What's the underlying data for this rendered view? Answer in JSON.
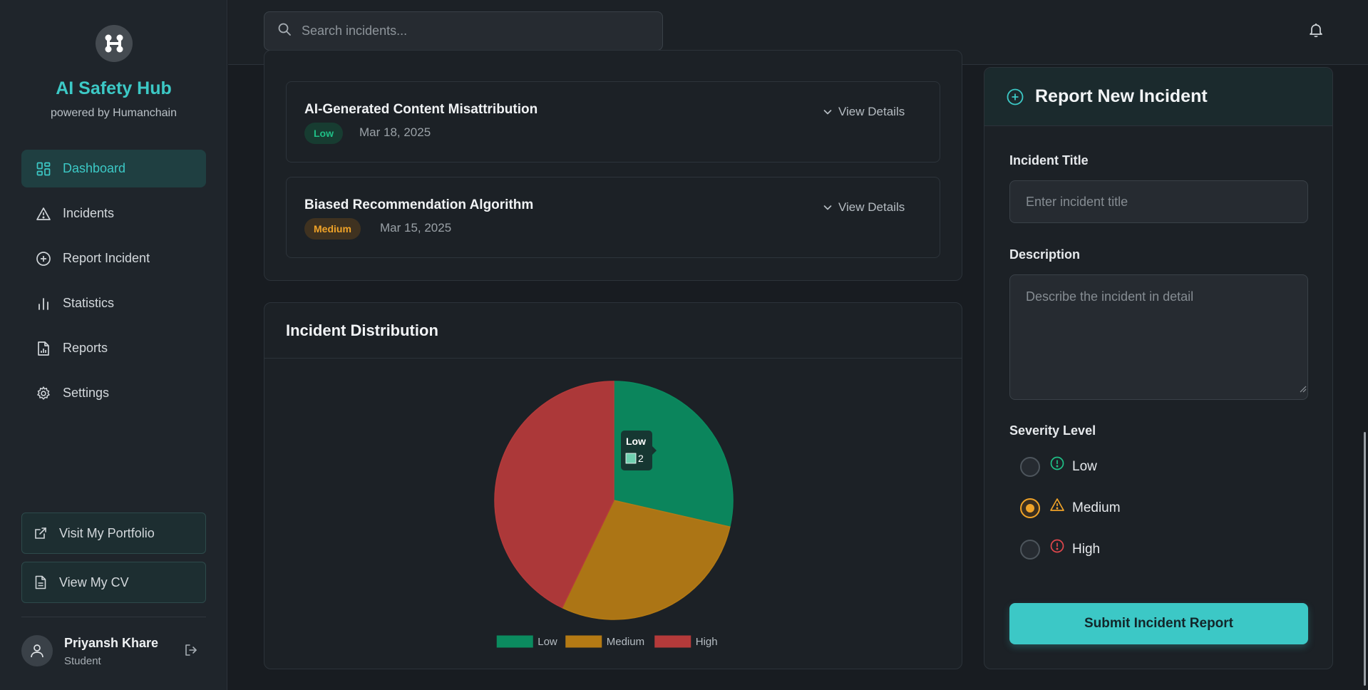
{
  "brand": {
    "title": "AI Safety Hub",
    "subtitle": "powered by Humanchain"
  },
  "search": {
    "placeholder": "Search incidents..."
  },
  "nav": {
    "items": [
      {
        "label": "Dashboard",
        "icon": "dashboard-icon",
        "active": true
      },
      {
        "label": "Incidents",
        "icon": "warning-icon",
        "active": false
      },
      {
        "label": "Report Incident",
        "icon": "plus-circle-icon",
        "active": false
      },
      {
        "label": "Statistics",
        "icon": "bar-chart-icon",
        "active": false
      },
      {
        "label": "Reports",
        "icon": "file-icon",
        "active": false
      },
      {
        "label": "Settings",
        "icon": "gear-icon",
        "active": false
      }
    ]
  },
  "sidebar_links": {
    "portfolio": "Visit My Portfolio",
    "cv": "View My CV"
  },
  "user": {
    "name": "Priyansh Khare",
    "role": "Student"
  },
  "incidents": [
    {
      "title": "AI-Generated Content Misattribution",
      "severity": "Low",
      "date": "Mar 18, 2025",
      "action": "View Details"
    },
    {
      "title": "Biased Recommendation Algorithm",
      "severity": "Medium",
      "date": "Mar 15, 2025",
      "action": "View Details"
    }
  ],
  "distribution": {
    "title": "Incident Distribution"
  },
  "chart_data": {
    "type": "pie",
    "categories": [
      "Low",
      "Medium",
      "High"
    ],
    "values": [
      2,
      2,
      3
    ],
    "colors": [
      "#0b8b5f",
      "#b47a14",
      "#b43a3a"
    ],
    "legend": "bottom",
    "tooltip": {
      "label": "Low",
      "value": "2"
    }
  },
  "form": {
    "title": "Report New Incident",
    "title_label": "Incident Title",
    "title_placeholder": "Enter incident title",
    "description_label": "Description",
    "description_placeholder": "Describe the incident in detail",
    "severity_label": "Severity Level",
    "severity_options": [
      {
        "label": "Low",
        "color": "#1fbf86",
        "checked": false
      },
      {
        "label": "Medium",
        "color": "#f0a328",
        "checked": true
      },
      {
        "label": "High",
        "color": "#e0474c",
        "checked": false
      }
    ],
    "submit_label": "Submit Incident Report"
  },
  "colors": {
    "accent": "#3cc9c6",
    "low": "#1fbf86",
    "medium": "#f0a328",
    "high": "#e0474c"
  }
}
